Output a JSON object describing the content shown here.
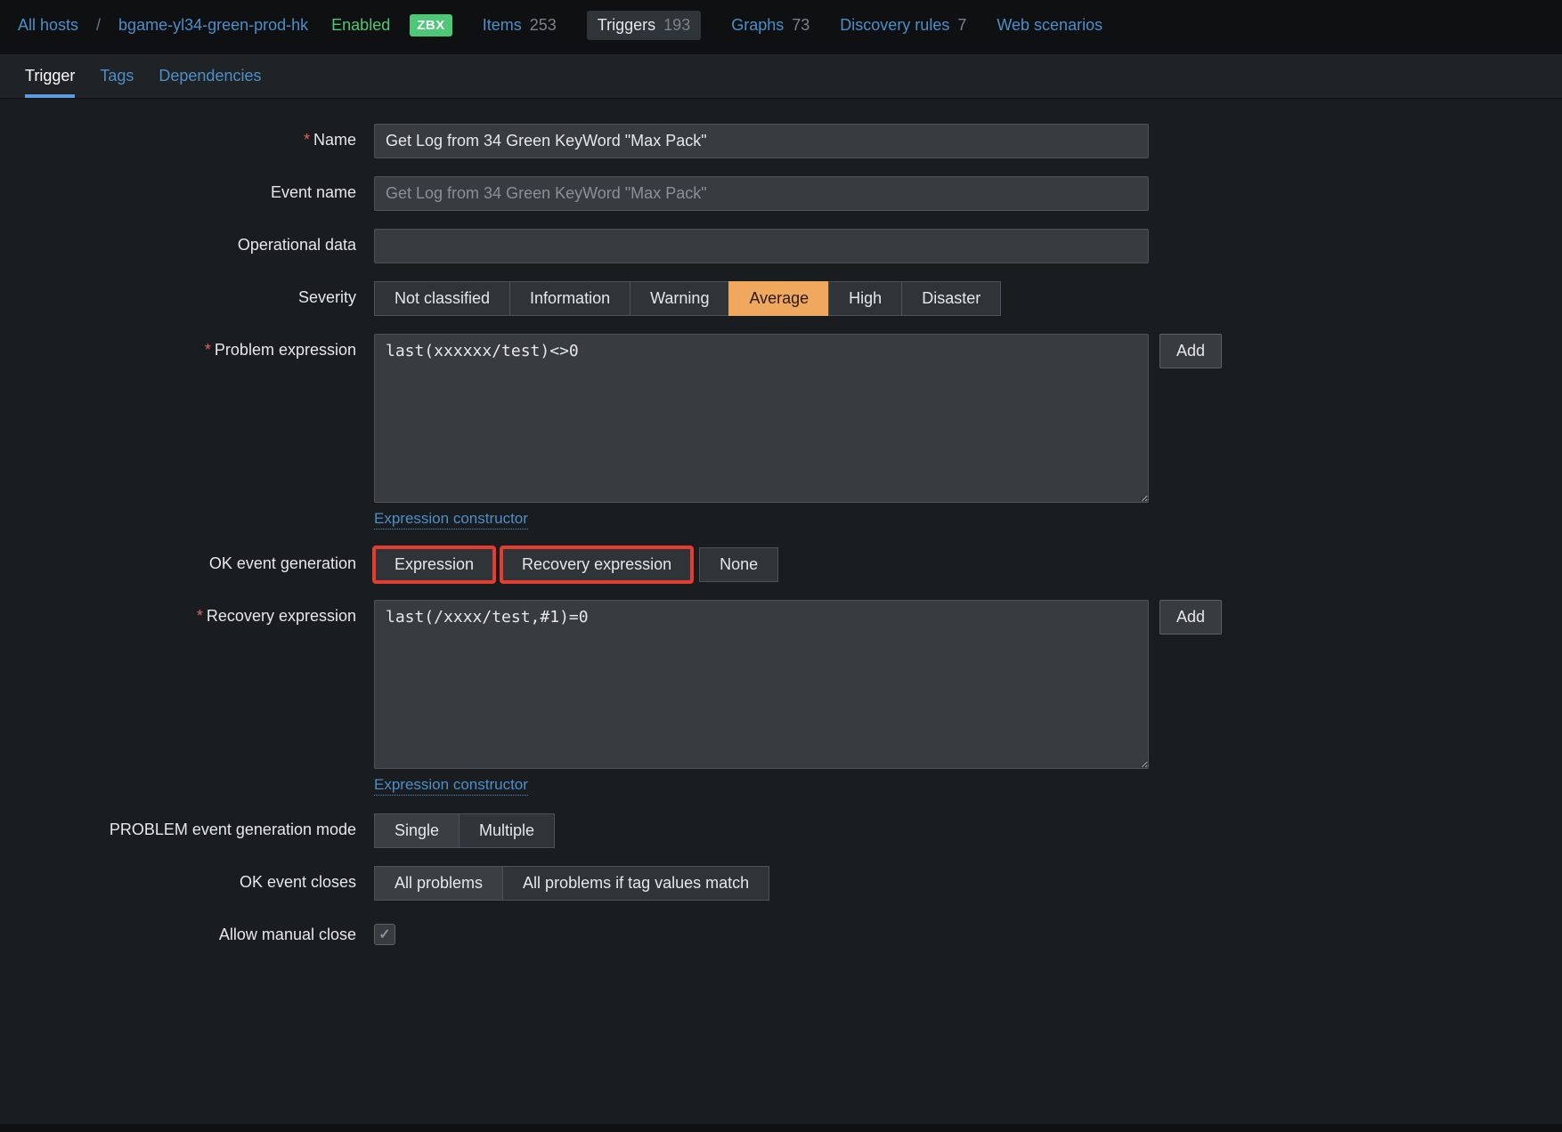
{
  "breadcrumb": {
    "all_hosts": "All hosts",
    "sep": "/",
    "host": "bgame-yl34-green-prod-hk"
  },
  "status": {
    "enabled": "Enabled",
    "zbx": "ZBX"
  },
  "nav": {
    "items": {
      "label": "Items",
      "count": "253"
    },
    "triggers": {
      "label": "Triggers",
      "count": "193"
    },
    "graphs": {
      "label": "Graphs",
      "count": "73"
    },
    "discovery": {
      "label": "Discovery rules",
      "count": "7"
    },
    "web": {
      "label": "Web scenarios",
      "count": ""
    }
  },
  "tabs": {
    "trigger": "Trigger",
    "tags": "Tags",
    "dependencies": "Dependencies"
  },
  "form": {
    "name": {
      "label": "Name",
      "value": "Get Log from 34 Green KeyWord \"Max Pack\""
    },
    "event_name": {
      "label": "Event name",
      "value": "",
      "placeholder": "Get Log from 34 Green KeyWord \"Max Pack\""
    },
    "op_data": {
      "label": "Operational data",
      "value": ""
    },
    "severity": {
      "label": "Severity",
      "options": [
        "Not classified",
        "Information",
        "Warning",
        "Average",
        "High",
        "Disaster"
      ],
      "selected": "Average"
    },
    "problem_expr": {
      "label": "Problem expression",
      "value": "last(xxxxxx/test)<>0",
      "add": "Add",
      "constructor": "Expression constructor"
    },
    "ok_event_gen": {
      "label": "OK event generation",
      "options": [
        "Expression",
        "Recovery expression",
        "None"
      ],
      "highlighted": [
        "Expression",
        "Recovery expression"
      ]
    },
    "recovery_expr": {
      "label": "Recovery expression",
      "value": "last(/xxxx/test,#1)=0",
      "add": "Add",
      "constructor": "Expression constructor"
    },
    "problem_mode": {
      "label": "PROBLEM event generation mode",
      "options": [
        "Single",
        "Multiple"
      ],
      "selected": "Single"
    },
    "ok_closes": {
      "label": "OK event closes",
      "options": [
        "All problems",
        "All problems if tag values match"
      ],
      "selected": "All problems"
    },
    "manual_close": {
      "label": "Allow manual close",
      "checked": true
    }
  }
}
